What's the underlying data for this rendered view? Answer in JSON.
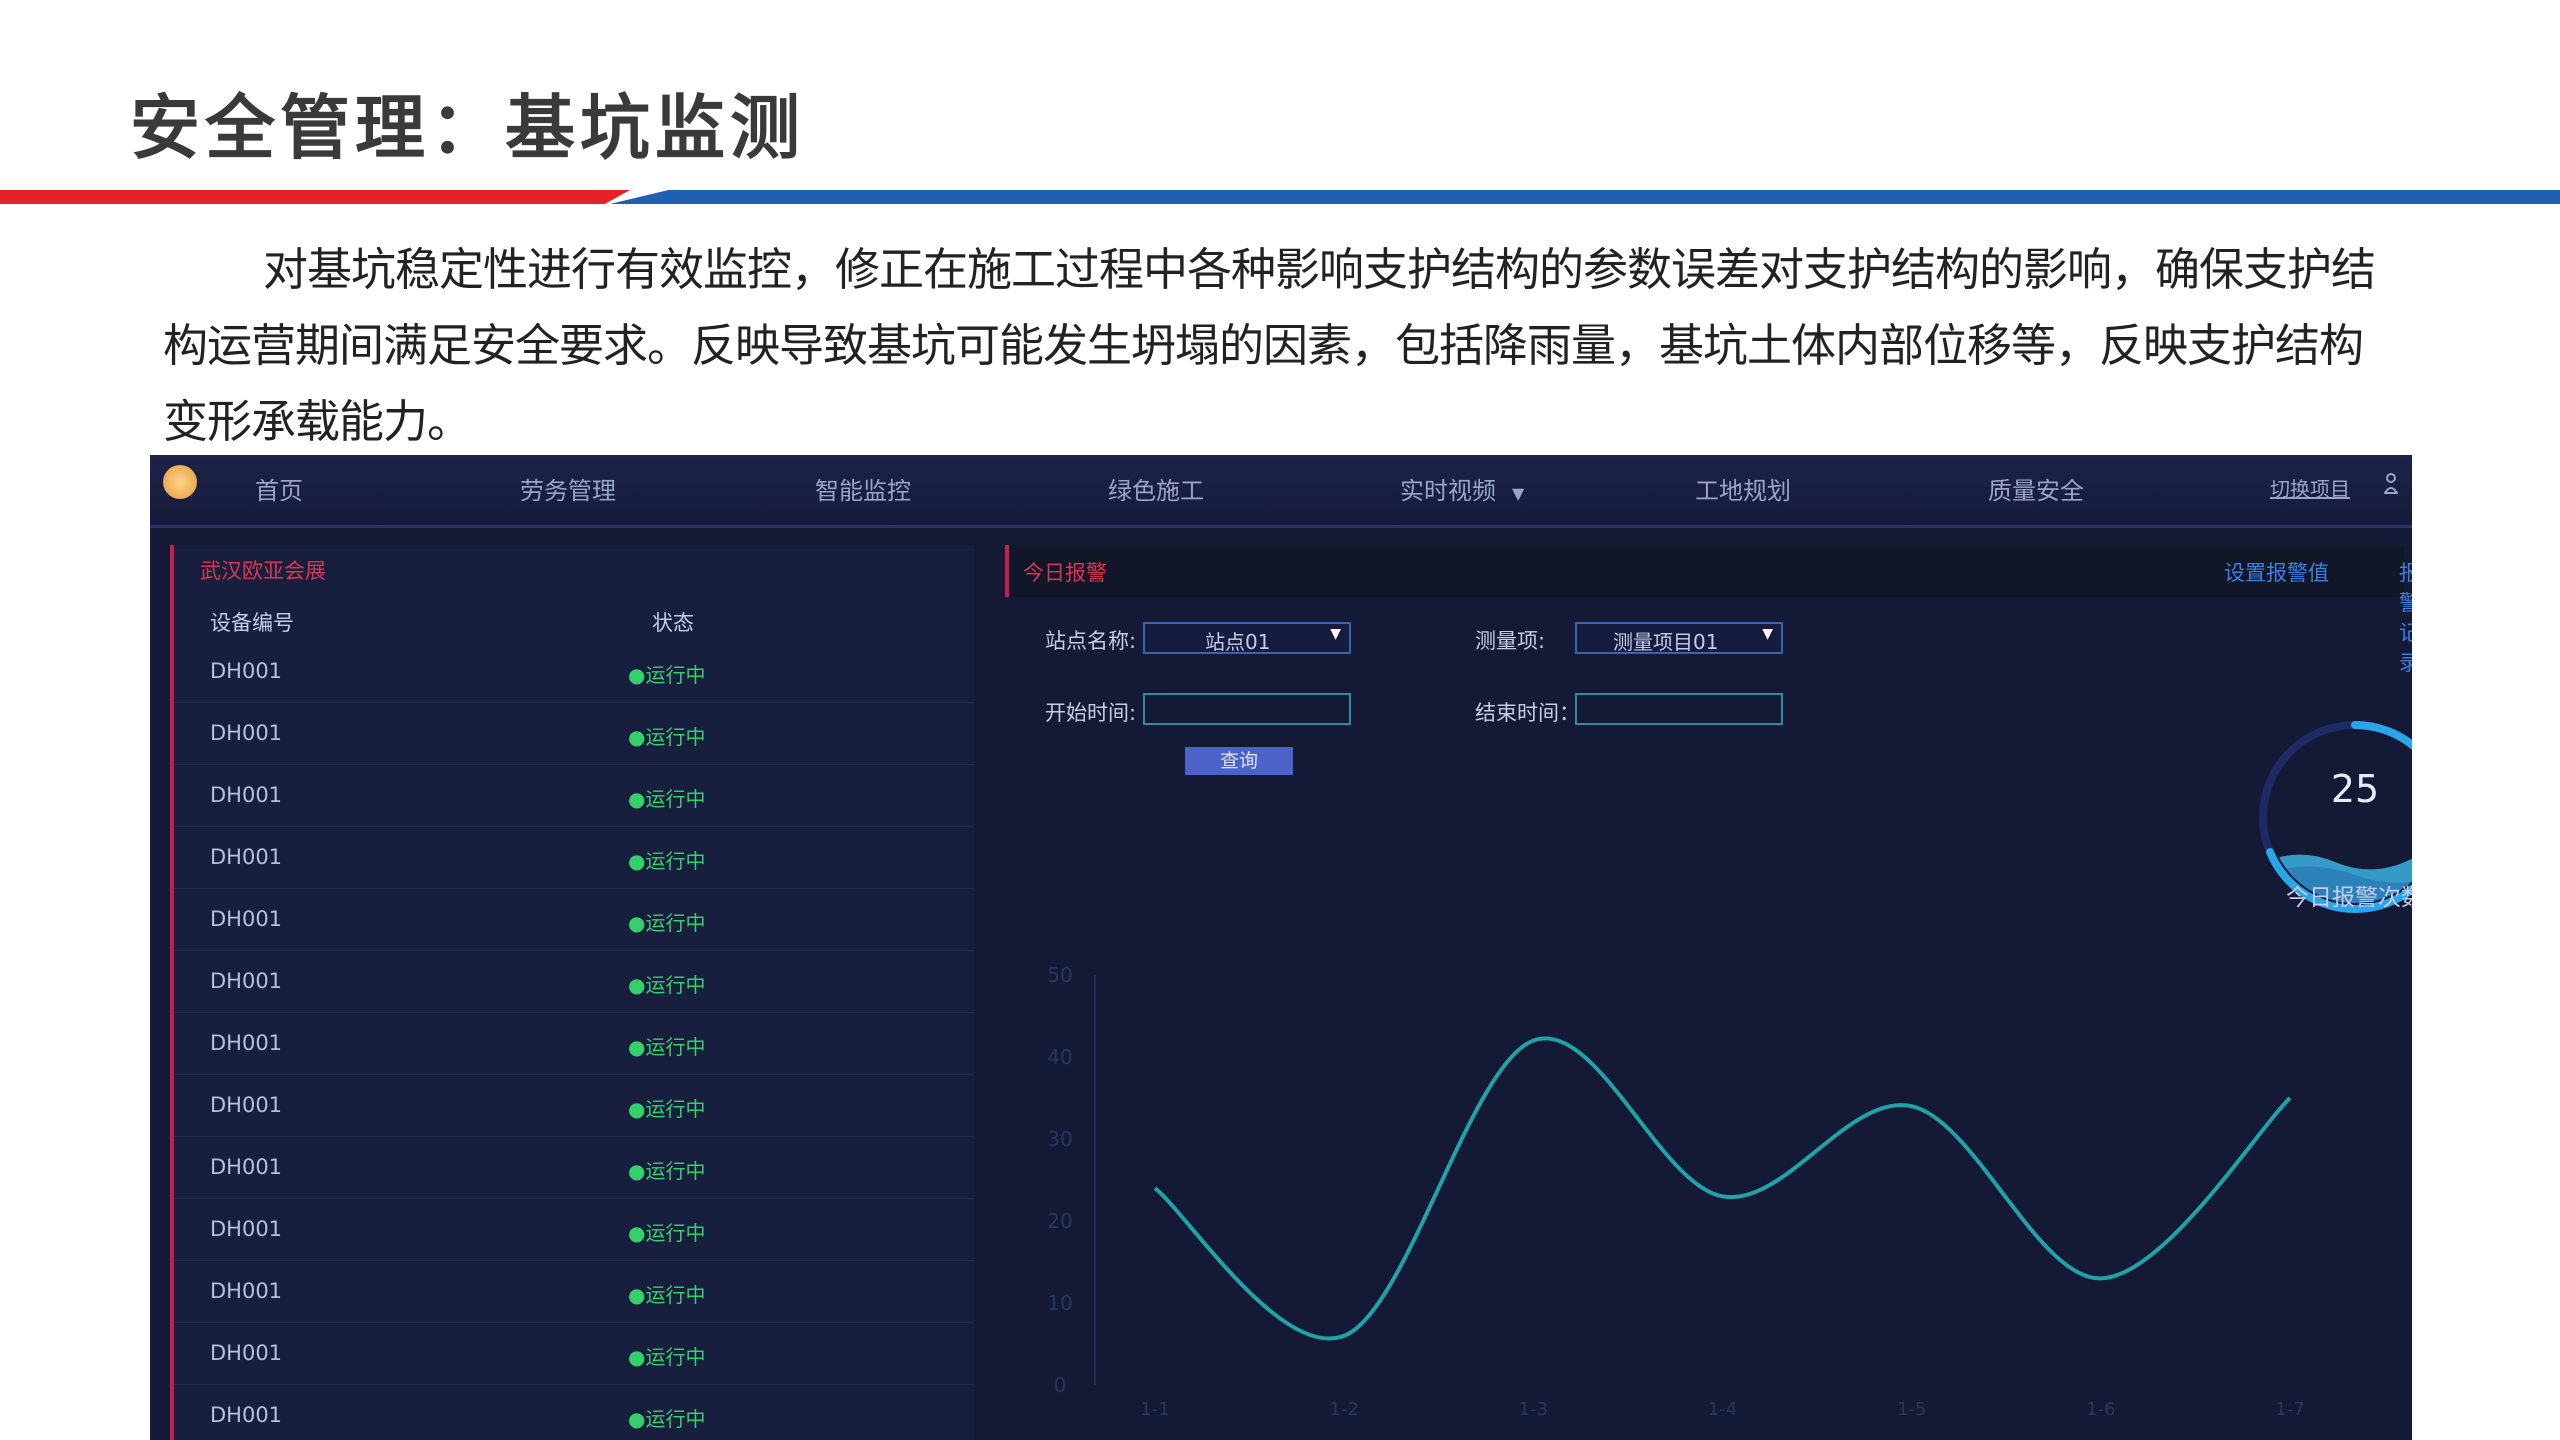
{
  "slide": {
    "title": "安全管理：基坑监测",
    "intro": "对基坑稳定性进行有效监控，修正在施工过程中各种影响支护结构的参数误差对支护结构的影响，确保支护结构运营期间满足安全要求。反映导致基坑可能发生坍塌的因素，包括降雨量，基坑土体内部位移等，反映支护结构变形承载能力。",
    "bar_colors": {
      "left": "#e62129",
      "right": "#1f5fb4"
    }
  },
  "nav": {
    "items": [
      "首页",
      "劳务管理",
      "智能监控",
      "绿色施工",
      "实时视频",
      "工地规划",
      "质量安全"
    ],
    "right_label": "切换项目"
  },
  "left_panel": {
    "title": "武汉欧亚会展",
    "col_device": "设备编号",
    "col_status": "状态",
    "rows": [
      {
        "device": "DH001",
        "status": "●运行中"
      },
      {
        "device": "DH001",
        "status": "●运行中"
      },
      {
        "device": "DH001",
        "status": "●运行中"
      },
      {
        "device": "DH001",
        "status": "●运行中"
      },
      {
        "device": "DH001",
        "status": "●运行中"
      },
      {
        "device": "DH001",
        "status": "●运行中"
      },
      {
        "device": "DH001",
        "status": "●运行中"
      },
      {
        "device": "DH001",
        "status": "●运行中"
      },
      {
        "device": "DH001",
        "status": "●运行中"
      },
      {
        "device": "DH001",
        "status": "●运行中"
      },
      {
        "device": "DH001",
        "status": "●运行中"
      },
      {
        "device": "DH001",
        "status": "●运行中"
      },
      {
        "device": "DH001",
        "status": "●运行中"
      }
    ]
  },
  "right_panel": {
    "title": "今日报警",
    "link_set_threshold": "设置报警值",
    "link_records": "报警记录",
    "station_label": "站点名称:",
    "station_value": "站点01",
    "measure_label": "测量项:",
    "measure_value": "测量项目01",
    "start_label": "开始时间:",
    "end_label": "结束时间：",
    "start_value": "",
    "end_value": "",
    "query_label": "查询",
    "gauge_value": "25",
    "gauge_label": "今日报警次数"
  },
  "chart_data": {
    "type": "line",
    "title": "",
    "xlabel": "",
    "ylabel": "",
    "ylim": [
      0,
      50
    ],
    "yticks": [
      0,
      10,
      20,
      30,
      40,
      50
    ],
    "x": [
      "1-1",
      "1-2",
      "1-3",
      "1-4",
      "1-5",
      "1-6",
      "1-7"
    ],
    "series": [
      {
        "values": [
          24,
          6,
          42,
          23,
          34,
          13,
          35
        ]
      }
    ],
    "line_color": "#1fa3a8",
    "grid": false
  }
}
